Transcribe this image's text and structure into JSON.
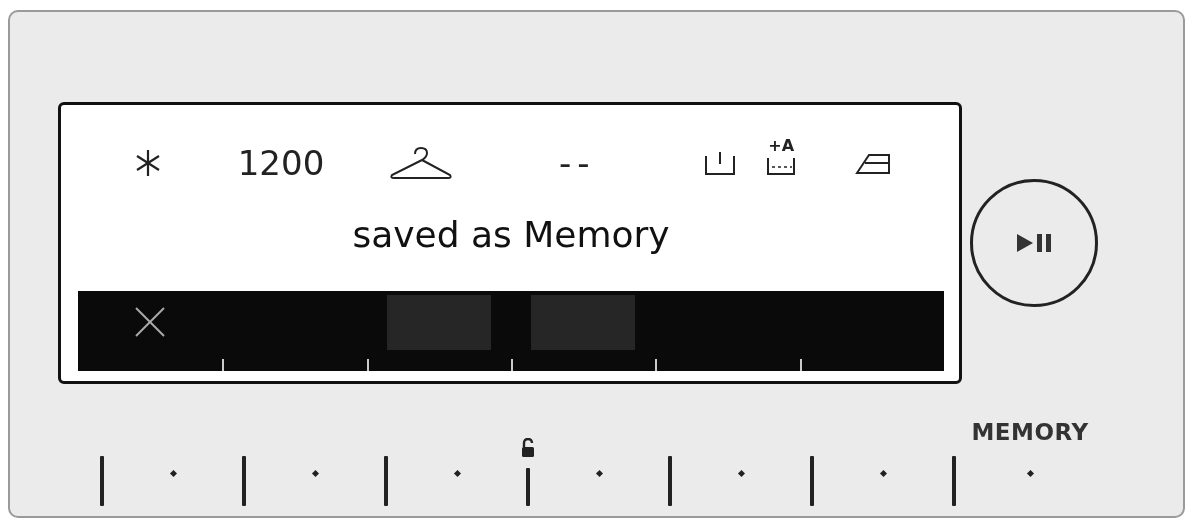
{
  "display": {
    "spin_speed": "1200",
    "temperature": "--",
    "extra_rinse": "+A",
    "message": "saved as Memory",
    "bar_segments": [
      {
        "kind": "cancel"
      },
      {
        "kind": "empty"
      },
      {
        "kind": "block"
      },
      {
        "kind": "block"
      },
      {
        "kind": "empty"
      },
      {
        "kind": "empty"
      }
    ]
  },
  "keys": [
    {
      "kind": "plain",
      "lock_before": false
    },
    {
      "kind": "plain",
      "lock_before": false
    },
    {
      "kind": "plain",
      "lock_before": false
    },
    {
      "kind": "plain",
      "lock_before": true
    },
    {
      "kind": "plain",
      "lock_before": false
    },
    {
      "kind": "plain",
      "lock_before": false
    },
    {
      "kind": "memory",
      "label": "MEMORY",
      "lock_before": false
    }
  ]
}
